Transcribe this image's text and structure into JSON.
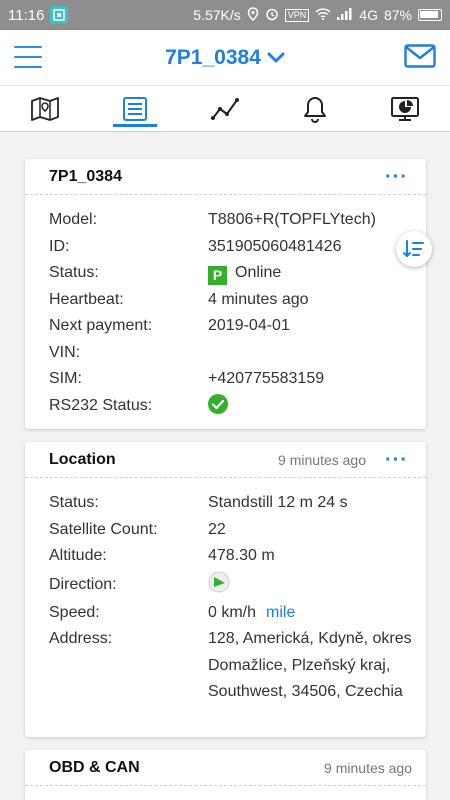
{
  "status_bar": {
    "time": "11:16",
    "speed": "5.57K/s",
    "vpn": "VPN",
    "network": "4G",
    "battery": "87%"
  },
  "header": {
    "title": "7P1_0384",
    "menu_icon": "hamburger-icon",
    "mail_icon": "mail-icon",
    "accent": "#1f7fe0"
  },
  "tabs": [
    {
      "icon": "map-icon",
      "active": false
    },
    {
      "icon": "list-icon",
      "active": true
    },
    {
      "icon": "chart-line-icon",
      "active": false
    },
    {
      "icon": "bell-icon",
      "active": false
    },
    {
      "icon": "report-icon",
      "active": false
    }
  ],
  "device_card": {
    "title": "7P1_0384",
    "more": "···",
    "rows": [
      {
        "key": "Model:",
        "value": "T8806+R(TOPFLYtech)"
      },
      {
        "key": "ID:",
        "value": "351905060481426"
      },
      {
        "key": "Status:",
        "value": "Online",
        "badge": "P"
      },
      {
        "key": "Heartbeat:",
        "value": "4 minutes ago"
      },
      {
        "key": "Next payment:",
        "value": "2019-04-01"
      },
      {
        "key": "VIN:",
        "value": ""
      },
      {
        "key": "SIM:",
        "value": "+420775583159"
      },
      {
        "key": "RS232 Status:",
        "value": ""
      }
    ]
  },
  "location_card": {
    "title": "Location",
    "time": "9 minutes ago",
    "more": "···",
    "rows": [
      {
        "key": "Status:",
        "value": "Standstill 12 m 24 s"
      },
      {
        "key": "Satellite Count:",
        "value": "22"
      },
      {
        "key": "Altitude:",
        "value": "478.30 m"
      },
      {
        "key": "Direction:",
        "value": ""
      },
      {
        "key": "Speed:",
        "value": "0 km/h",
        "link": "mile"
      },
      {
        "key": "Address:",
        "value": "128, Americká, Kdyně, okres Domažlice, Plzeňský kraj, Southwest, 34506, Czechia"
      }
    ]
  },
  "obd_card": {
    "title": "OBD & CAN",
    "time": "9 minutes ago"
  }
}
